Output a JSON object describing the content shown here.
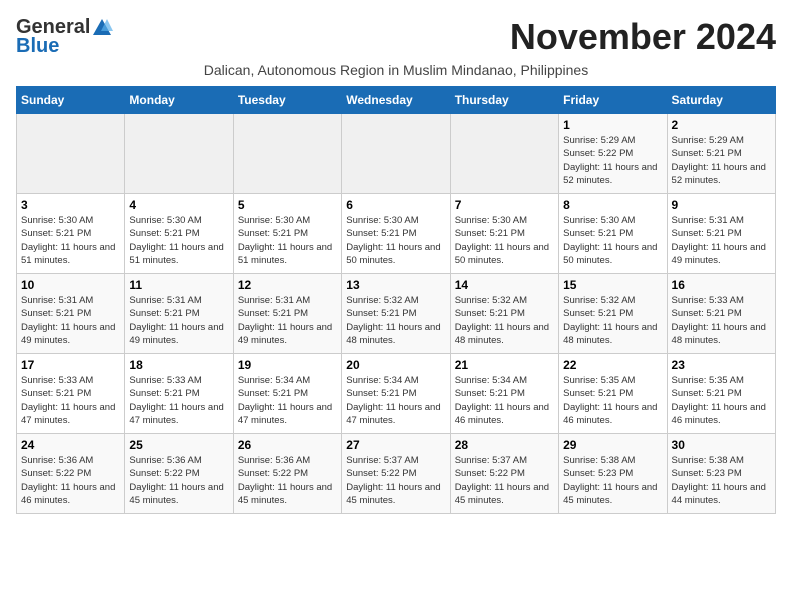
{
  "header": {
    "logo_general": "General",
    "logo_blue": "Blue",
    "month_title": "November 2024",
    "subtitle": "Dalican, Autonomous Region in Muslim Mindanao, Philippines"
  },
  "weekdays": [
    "Sunday",
    "Monday",
    "Tuesday",
    "Wednesday",
    "Thursday",
    "Friday",
    "Saturday"
  ],
  "weeks": [
    [
      {
        "day": "",
        "info": ""
      },
      {
        "day": "",
        "info": ""
      },
      {
        "day": "",
        "info": ""
      },
      {
        "day": "",
        "info": ""
      },
      {
        "day": "",
        "info": ""
      },
      {
        "day": "1",
        "info": "Sunrise: 5:29 AM\nSunset: 5:22 PM\nDaylight: 11 hours and 52 minutes."
      },
      {
        "day": "2",
        "info": "Sunrise: 5:29 AM\nSunset: 5:21 PM\nDaylight: 11 hours and 52 minutes."
      }
    ],
    [
      {
        "day": "3",
        "info": "Sunrise: 5:30 AM\nSunset: 5:21 PM\nDaylight: 11 hours and 51 minutes."
      },
      {
        "day": "4",
        "info": "Sunrise: 5:30 AM\nSunset: 5:21 PM\nDaylight: 11 hours and 51 minutes."
      },
      {
        "day": "5",
        "info": "Sunrise: 5:30 AM\nSunset: 5:21 PM\nDaylight: 11 hours and 51 minutes."
      },
      {
        "day": "6",
        "info": "Sunrise: 5:30 AM\nSunset: 5:21 PM\nDaylight: 11 hours and 50 minutes."
      },
      {
        "day": "7",
        "info": "Sunrise: 5:30 AM\nSunset: 5:21 PM\nDaylight: 11 hours and 50 minutes."
      },
      {
        "day": "8",
        "info": "Sunrise: 5:30 AM\nSunset: 5:21 PM\nDaylight: 11 hours and 50 minutes."
      },
      {
        "day": "9",
        "info": "Sunrise: 5:31 AM\nSunset: 5:21 PM\nDaylight: 11 hours and 49 minutes."
      }
    ],
    [
      {
        "day": "10",
        "info": "Sunrise: 5:31 AM\nSunset: 5:21 PM\nDaylight: 11 hours and 49 minutes."
      },
      {
        "day": "11",
        "info": "Sunrise: 5:31 AM\nSunset: 5:21 PM\nDaylight: 11 hours and 49 minutes."
      },
      {
        "day": "12",
        "info": "Sunrise: 5:31 AM\nSunset: 5:21 PM\nDaylight: 11 hours and 49 minutes."
      },
      {
        "day": "13",
        "info": "Sunrise: 5:32 AM\nSunset: 5:21 PM\nDaylight: 11 hours and 48 minutes."
      },
      {
        "day": "14",
        "info": "Sunrise: 5:32 AM\nSunset: 5:21 PM\nDaylight: 11 hours and 48 minutes."
      },
      {
        "day": "15",
        "info": "Sunrise: 5:32 AM\nSunset: 5:21 PM\nDaylight: 11 hours and 48 minutes."
      },
      {
        "day": "16",
        "info": "Sunrise: 5:33 AM\nSunset: 5:21 PM\nDaylight: 11 hours and 48 minutes."
      }
    ],
    [
      {
        "day": "17",
        "info": "Sunrise: 5:33 AM\nSunset: 5:21 PM\nDaylight: 11 hours and 47 minutes."
      },
      {
        "day": "18",
        "info": "Sunrise: 5:33 AM\nSunset: 5:21 PM\nDaylight: 11 hours and 47 minutes."
      },
      {
        "day": "19",
        "info": "Sunrise: 5:34 AM\nSunset: 5:21 PM\nDaylight: 11 hours and 47 minutes."
      },
      {
        "day": "20",
        "info": "Sunrise: 5:34 AM\nSunset: 5:21 PM\nDaylight: 11 hours and 47 minutes."
      },
      {
        "day": "21",
        "info": "Sunrise: 5:34 AM\nSunset: 5:21 PM\nDaylight: 11 hours and 46 minutes."
      },
      {
        "day": "22",
        "info": "Sunrise: 5:35 AM\nSunset: 5:21 PM\nDaylight: 11 hours and 46 minutes."
      },
      {
        "day": "23",
        "info": "Sunrise: 5:35 AM\nSunset: 5:21 PM\nDaylight: 11 hours and 46 minutes."
      }
    ],
    [
      {
        "day": "24",
        "info": "Sunrise: 5:36 AM\nSunset: 5:22 PM\nDaylight: 11 hours and 46 minutes."
      },
      {
        "day": "25",
        "info": "Sunrise: 5:36 AM\nSunset: 5:22 PM\nDaylight: 11 hours and 45 minutes."
      },
      {
        "day": "26",
        "info": "Sunrise: 5:36 AM\nSunset: 5:22 PM\nDaylight: 11 hours and 45 minutes."
      },
      {
        "day": "27",
        "info": "Sunrise: 5:37 AM\nSunset: 5:22 PM\nDaylight: 11 hours and 45 minutes."
      },
      {
        "day": "28",
        "info": "Sunrise: 5:37 AM\nSunset: 5:22 PM\nDaylight: 11 hours and 45 minutes."
      },
      {
        "day": "29",
        "info": "Sunrise: 5:38 AM\nSunset: 5:23 PM\nDaylight: 11 hours and 45 minutes."
      },
      {
        "day": "30",
        "info": "Sunrise: 5:38 AM\nSunset: 5:23 PM\nDaylight: 11 hours and 44 minutes."
      }
    ]
  ]
}
